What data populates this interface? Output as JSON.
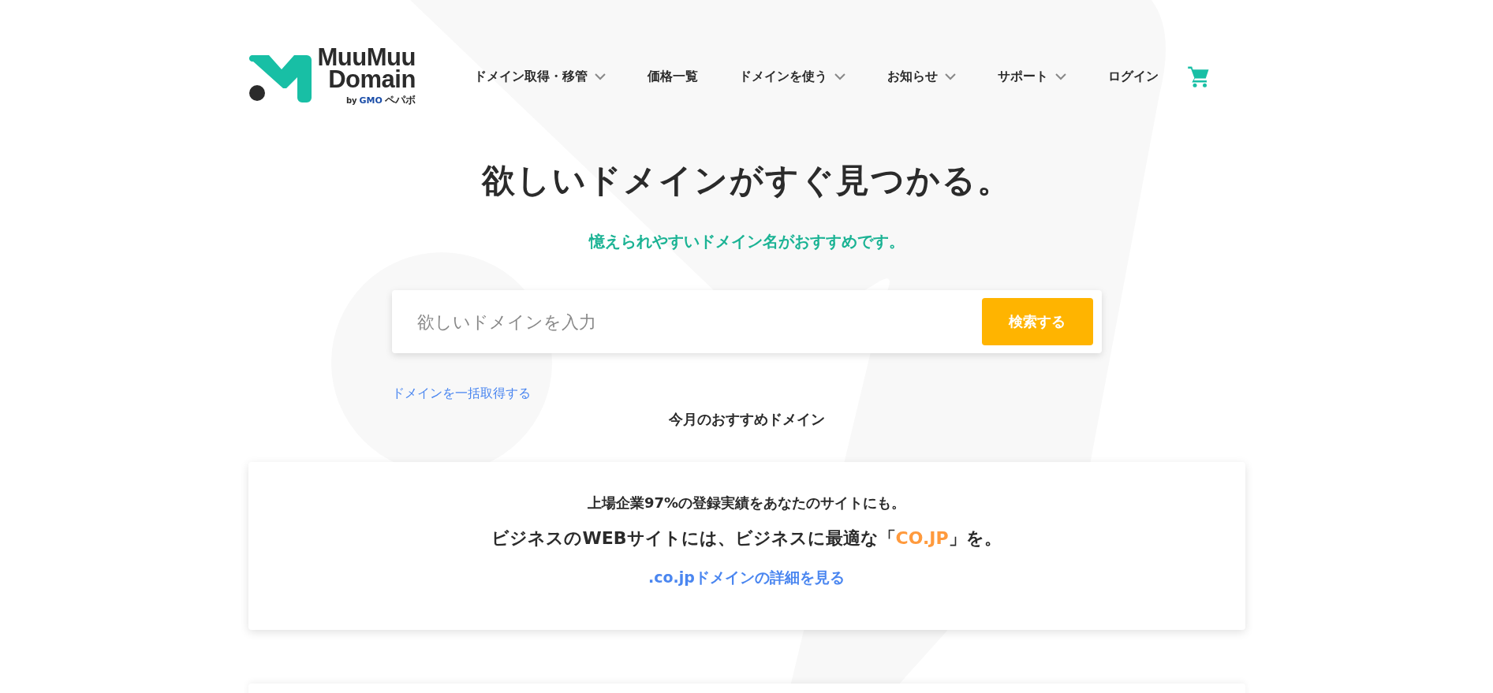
{
  "logo": {
    "line1": "MuuMuu",
    "line2": "Domain",
    "by": "by",
    "brand_a": "GMO",
    "brand_b": "ペパボ"
  },
  "nav": [
    {
      "label": "ドメイン取得・移管",
      "dropdown": true
    },
    {
      "label": "価格一覧",
      "dropdown": false
    },
    {
      "label": "ドメインを使う",
      "dropdown": true
    },
    {
      "label": "お知らせ",
      "dropdown": true
    },
    {
      "label": "サポート",
      "dropdown": true
    },
    {
      "label": "ログイン",
      "dropdown": false
    }
  ],
  "hero": {
    "title": "欲しいドメインがすぐ見つかる。",
    "subtitle": "憶えられやすいドメイン名がおすすめです。"
  },
  "search": {
    "placeholder": "欲しいドメインを入力",
    "button": "検索する"
  },
  "bulk_link": "ドメインを一括取得する",
  "recommend_title": "今月のおすすめドメイン",
  "promo": {
    "line1": "上場企業97%の登録実績をあなたのサイトにも。",
    "line2_before": "ビジネスのWEBサイトには、ビジネスに最適な「",
    "line2_highlight": "CO.JP",
    "line2_after": "」を。",
    "link": ".co.jpドメインの詳細を見る"
  }
}
